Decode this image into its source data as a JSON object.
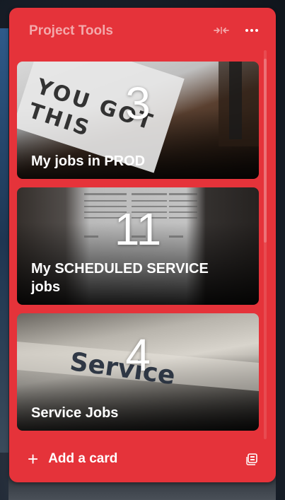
{
  "list": {
    "title": "Project Tools",
    "collapse_icon": "collapse-arrows-icon",
    "more_icon": "ellipsis-icon"
  },
  "cards": [
    {
      "count": "3",
      "label": "My jobs in PROD",
      "image_text": "YOU GOT THIS"
    },
    {
      "count": "11",
      "label": "My SCHEDULED SERVICE jobs",
      "image_text": ""
    },
    {
      "count": "4",
      "label": "Service Jobs",
      "image_text": "Service"
    },
    {
      "count": "",
      "label": ""
    }
  ],
  "footer": {
    "add_label": "Add a card",
    "add_icon": "plus-icon",
    "template_icon": "card-template-icon"
  },
  "colors": {
    "list_background": "#e5333a",
    "title_color": "#f3a9ab"
  }
}
